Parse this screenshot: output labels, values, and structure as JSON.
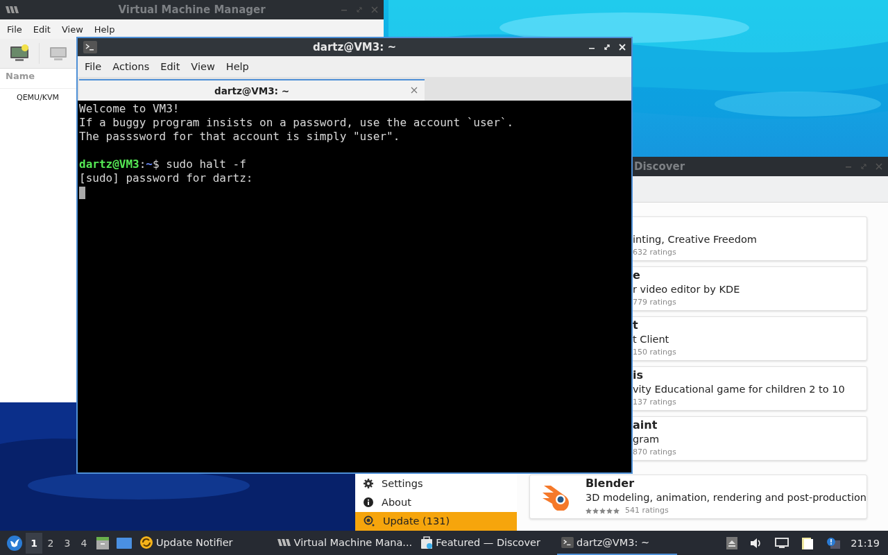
{
  "vmm_window": {
    "title": "Virtual Machine Manager",
    "menu": [
      "File",
      "Edit",
      "View",
      "Help"
    ],
    "column_header": "Name",
    "connections": [
      "QEMU/KVM"
    ]
  },
  "terminal_window": {
    "title": "dartz@VM3: ~",
    "menu": [
      "File",
      "Actions",
      "Edit",
      "View",
      "Help"
    ],
    "tabs": [
      {
        "label": "dartz@VM3: ~",
        "selected": true
      }
    ],
    "lines": [
      {
        "kind": "text",
        "text": "Welcome to VM3!"
      },
      {
        "kind": "text",
        "text": "If a buggy program insists on a password, use the account `user`."
      },
      {
        "kind": "text",
        "text": "The passsword for that account is simply \"user\"."
      },
      {
        "kind": "blank"
      },
      {
        "kind": "prompt",
        "user_host": "dartz@VM3",
        "separator": ":",
        "path": "~",
        "command": "$ sudo halt -f"
      },
      {
        "kind": "text",
        "text": "[sudo] password for dartz:"
      },
      {
        "kind": "cursor"
      }
    ]
  },
  "discover_window": {
    "title": "Discover",
    "apps": [
      {
        "kind": "clipped",
        "description": "inting, Creative Freedom",
        "ratings": "632 ratings"
      },
      {
        "kind": "clipped",
        "name": "e",
        "description": "r video editor by KDE",
        "ratings": "779 ratings"
      },
      {
        "kind": "clipped",
        "name": "t",
        "description": "t Client",
        "ratings": "150 ratings"
      },
      {
        "kind": "clipped",
        "name": "is",
        "description": "vity Educational game for children 2 to 10",
        "ratings": "137 ratings"
      },
      {
        "kind": "clipped",
        "name": "aint",
        "description": "gram",
        "ratings": "870 ratings"
      },
      {
        "kind": "full",
        "name": "Blender",
        "description": "3D modeling, animation, rendering and post-production",
        "stars": 5,
        "ratings": "541 ratings"
      }
    ],
    "sidebar": [
      {
        "kind": "settings",
        "label": "Settings",
        "selected": false
      },
      {
        "kind": "about",
        "label": "About",
        "selected": false
      },
      {
        "kind": "update",
        "label": "Update (131)",
        "selected": true
      }
    ]
  },
  "taskbar": {
    "desktops": [
      {
        "label": "1",
        "selected": true
      },
      {
        "label": "2",
        "selected": false
      },
      {
        "label": "3",
        "selected": false
      },
      {
        "label": "4",
        "selected": false
      }
    ],
    "tasks": [
      {
        "kind": "notifier",
        "label": "Update Notifier",
        "selected": false
      },
      {
        "kind": "vmm",
        "label": "Virtual Machine Mana...",
        "selected": false
      },
      {
        "kind": "discover",
        "label": "Featured — Discover",
        "selected": false
      },
      {
        "kind": "terminal",
        "label": "dartz@VM3: ~",
        "selected": true
      }
    ],
    "clock": "21:19"
  }
}
